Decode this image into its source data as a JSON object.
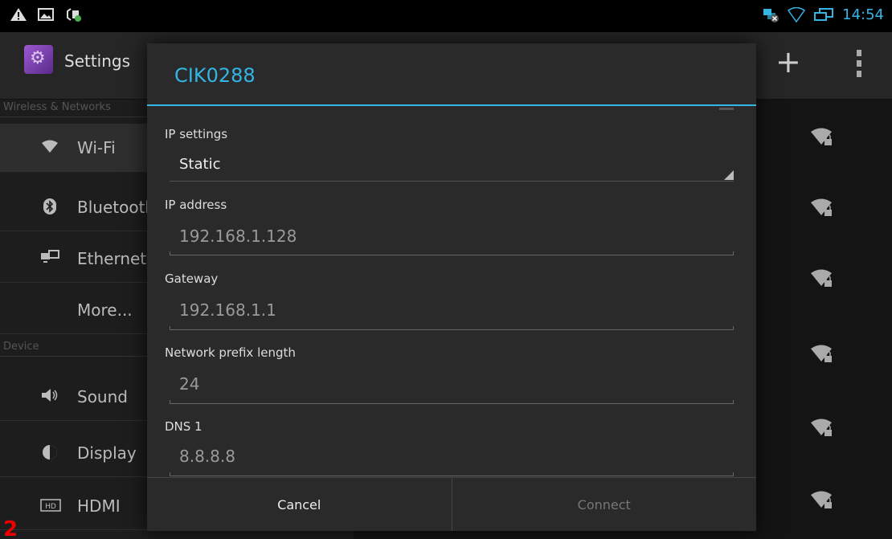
{
  "statusbar": {
    "time": "14:54",
    "left_icons": [
      "warning-icon",
      "screenshot-icon",
      "usb-debug-icon"
    ],
    "right_icons": [
      "ethernet-disconnected-icon",
      "wifi-icon",
      "network-icon"
    ]
  },
  "actionbar": {
    "title": "Settings",
    "add_label": "+"
  },
  "left_menu": {
    "section_wireless": "Wireless & Networks",
    "section_device": "Device",
    "items": [
      {
        "label": "Wi-Fi",
        "icon": "wifi-icon",
        "glyph": "ᯤ"
      },
      {
        "label": "Bluetooth",
        "icon": "bluetooth-icon",
        "glyph": "ᛒ"
      },
      {
        "label": "Ethernet",
        "icon": "ethernet-icon",
        "glyph": "🖧"
      },
      {
        "label": "More...",
        "icon": "",
        "glyph": ""
      },
      {
        "label": "Sound",
        "icon": "sound-icon",
        "glyph": "🔈"
      },
      {
        "label": "Display",
        "icon": "display-icon",
        "glyph": "◐"
      },
      {
        "label": "HDMI",
        "icon": "hdmi-icon",
        "glyph": "HD"
      }
    ]
  },
  "dialog": {
    "title": "CIK0288",
    "ip_settings_label": "IP settings",
    "ip_settings_value": "Static",
    "ip_address_label": "IP address",
    "ip_address_value": "192.168.1.128",
    "gateway_label": "Gateway",
    "gateway_value": "192.168.1.1",
    "prefix_label": "Network prefix length",
    "prefix_value": "24",
    "dns1_label": "DNS 1",
    "dns1_value": "8.8.8.8",
    "cancel_label": "Cancel",
    "connect_label": "Connect"
  },
  "corner_number": "2",
  "colors": {
    "accent": "#33b5e5",
    "dialog_bg": "#2a2a2a",
    "corner_number": "#e00000"
  }
}
